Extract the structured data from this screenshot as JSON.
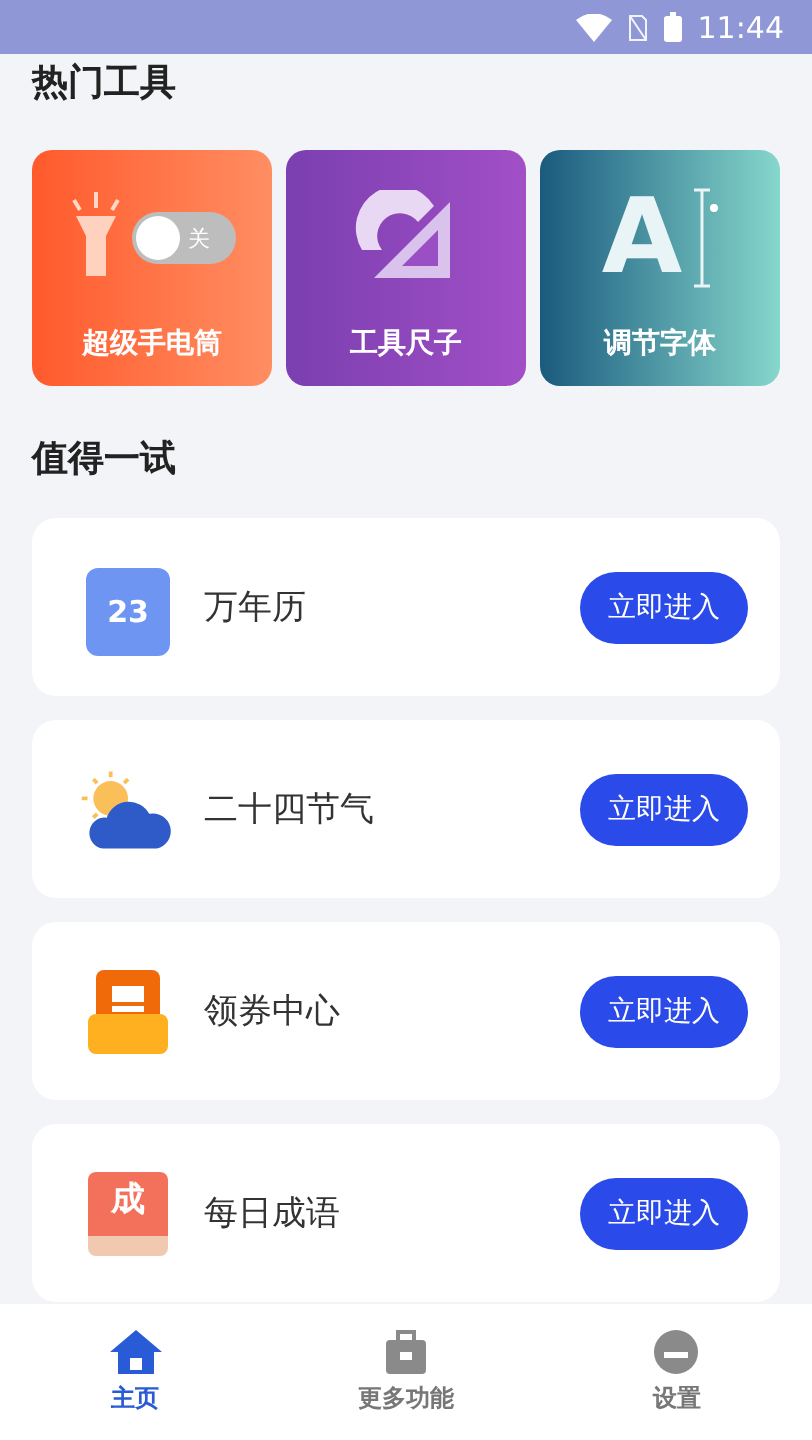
{
  "status_bar": {
    "time": "11:44"
  },
  "hot_tools": {
    "title": "热门工具",
    "tools": [
      {
        "kind": "flashlight",
        "label": "超级手电筒",
        "switch_label": "关",
        "on": false
      },
      {
        "kind": "ruler",
        "label": "工具尺子"
      },
      {
        "kind": "font",
        "label": "调节字体",
        "glyph": "A"
      }
    ]
  },
  "try_section": {
    "title": "值得一试",
    "items": [
      {
        "kind": "calendar",
        "name": "万年历",
        "icon_text": "23",
        "button": "立即进入"
      },
      {
        "kind": "weather",
        "name": "二十四节气",
        "button": "立即进入"
      },
      {
        "kind": "coupon",
        "name": "领券中心",
        "button": "立即进入"
      },
      {
        "kind": "idiom",
        "name": "每日成语",
        "icon_text": "成",
        "button": "立即进入"
      }
    ]
  },
  "tab_bar": [
    {
      "kind": "home",
      "label": "主页",
      "selected": true
    },
    {
      "kind": "toolbox",
      "label": "更多功能",
      "selected": false
    },
    {
      "kind": "profile",
      "label": "设置",
      "selected": false
    }
  ]
}
